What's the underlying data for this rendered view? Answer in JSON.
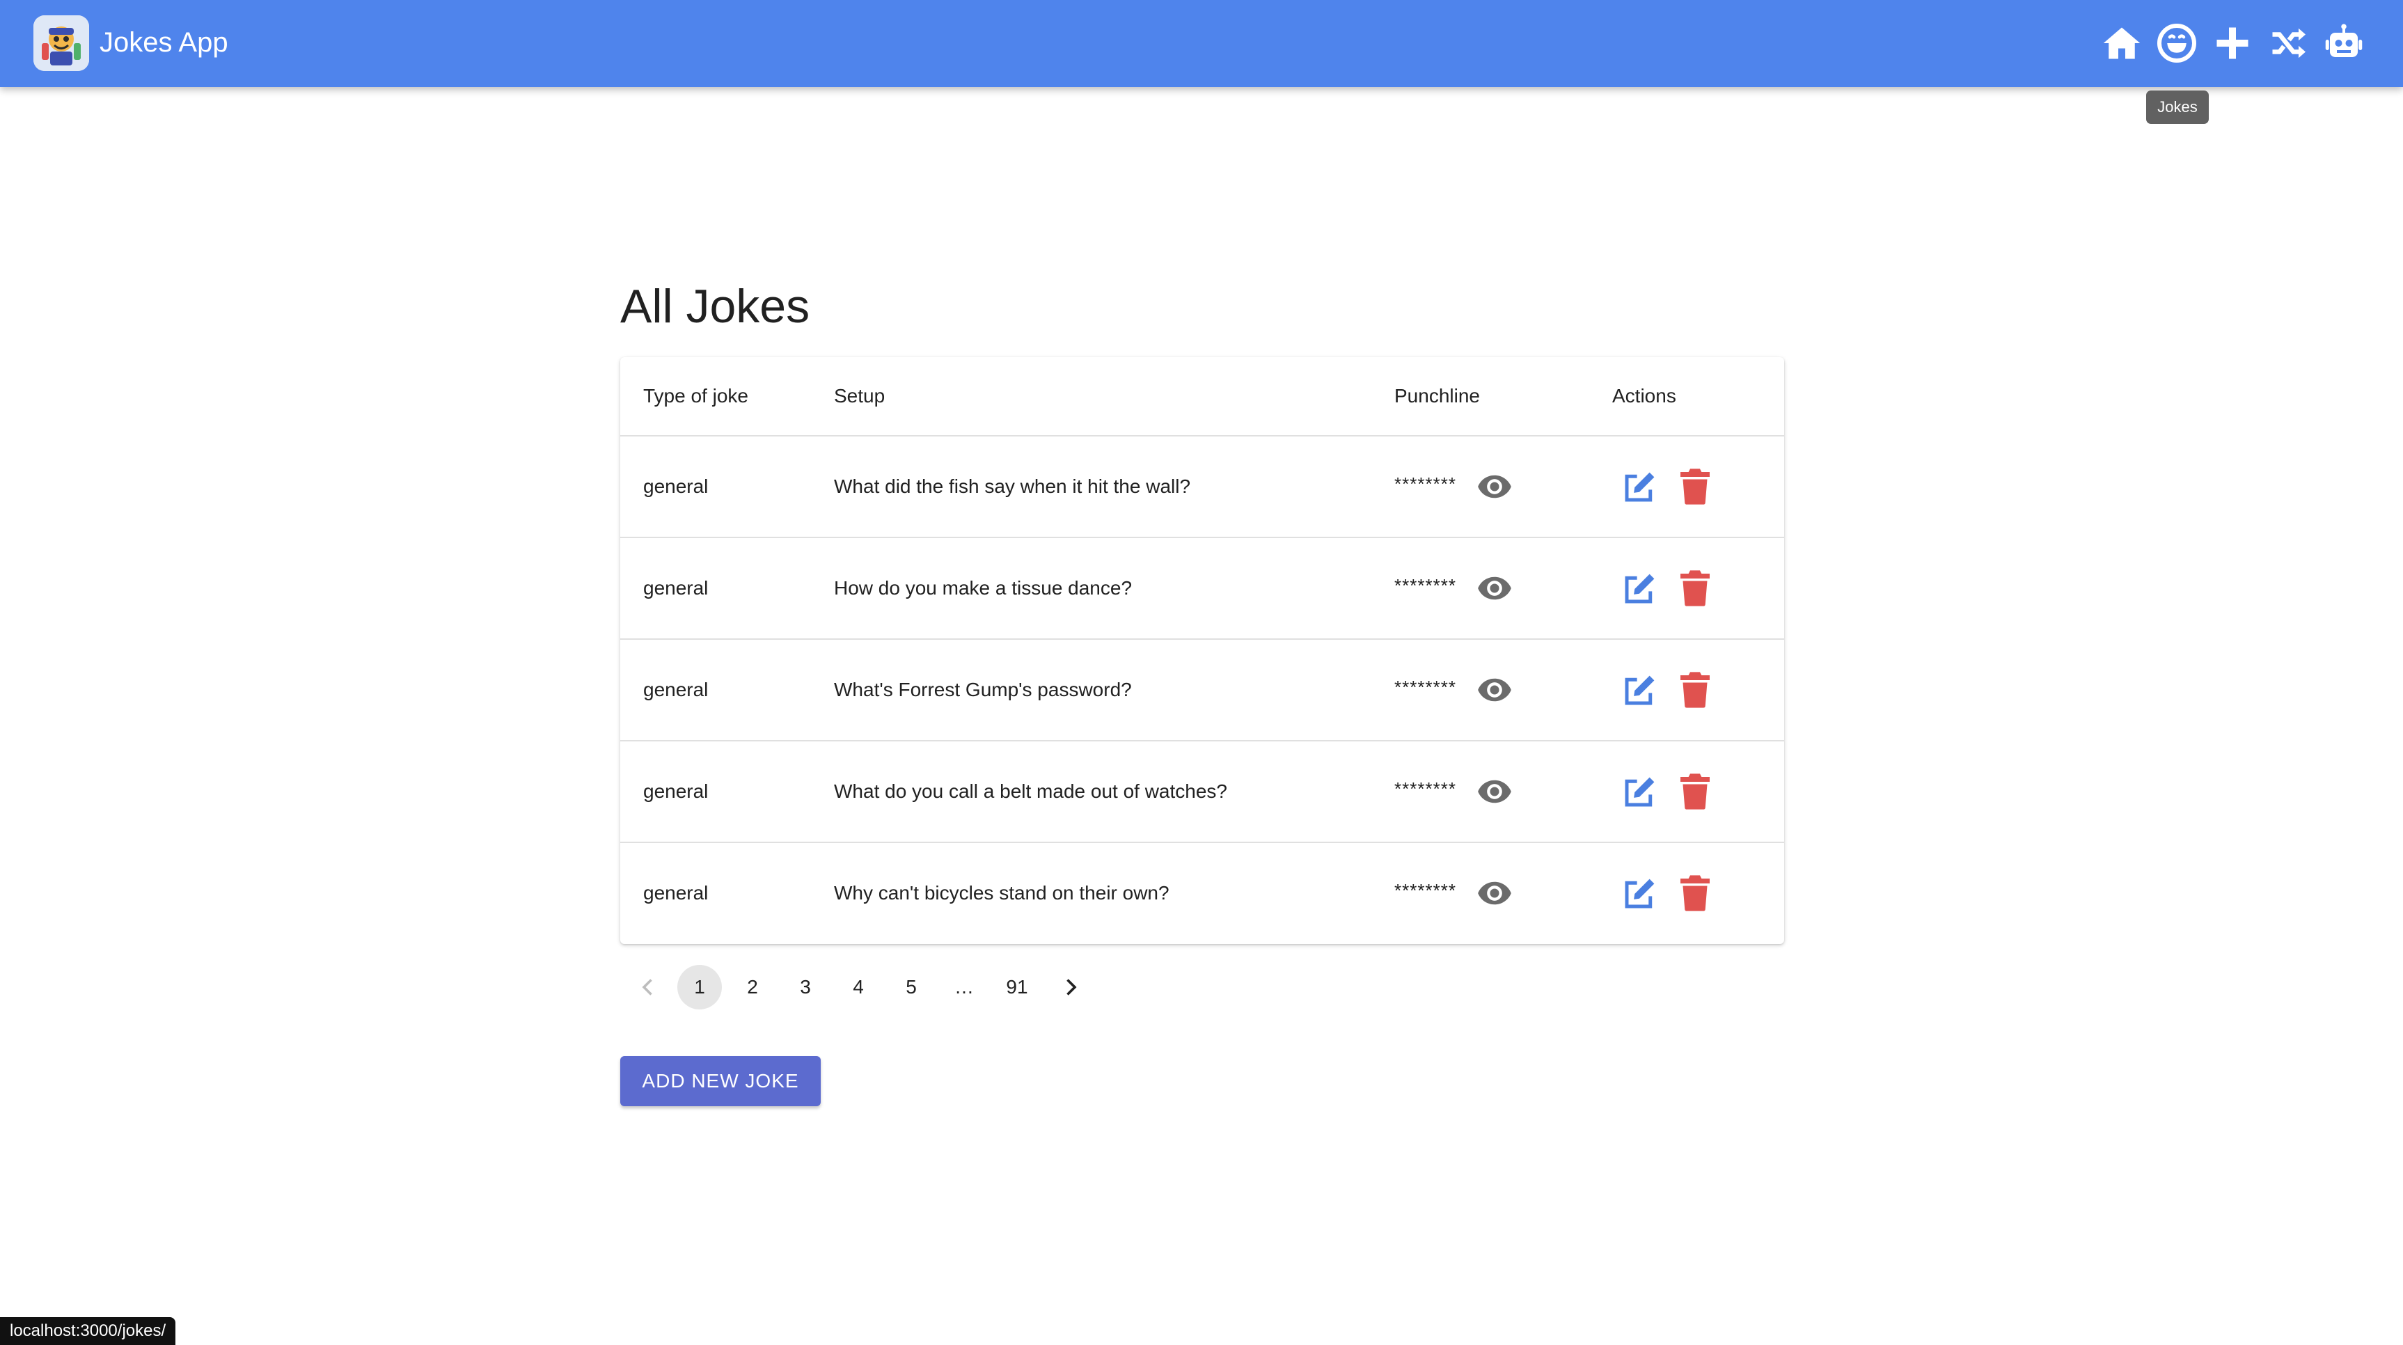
{
  "app": {
    "title": "Jokes App",
    "logo_text": "Jokes"
  },
  "nav": {
    "icons": [
      "home-icon",
      "joke-smile-icon",
      "plus-icon",
      "shuffle-icon",
      "robot-icon"
    ],
    "tooltip": "Jokes"
  },
  "page": {
    "title": "All Jokes"
  },
  "table": {
    "headers": {
      "type": "Type of joke",
      "setup": "Setup",
      "punchline": "Punchline",
      "actions": "Actions"
    },
    "rows": [
      {
        "type": "general",
        "setup": "What did the fish say when it hit the wall?",
        "punchline": "********"
      },
      {
        "type": "general",
        "setup": "How do you make a tissue dance?",
        "punchline": "********"
      },
      {
        "type": "general",
        "setup": "What's Forrest Gump's password?",
        "punchline": "********"
      },
      {
        "type": "general",
        "setup": "What do you call a belt made out of watches?",
        "punchline": "********"
      },
      {
        "type": "general",
        "setup": "Why can't bicycles stand on their own?",
        "punchline": "********"
      }
    ]
  },
  "pagination": {
    "pages": [
      "1",
      "2",
      "3",
      "4",
      "5",
      "…",
      "91"
    ],
    "current": "1"
  },
  "actions": {
    "add_button": "ADD NEW JOKE"
  },
  "status_bar": {
    "url": "localhost:3000/jokes/"
  },
  "colors": {
    "appbar": "#4f84ec",
    "edit": "#4a7fe0",
    "delete": "#e0524f",
    "eye": "#6b6b6b",
    "button": "#5c6bcf"
  }
}
